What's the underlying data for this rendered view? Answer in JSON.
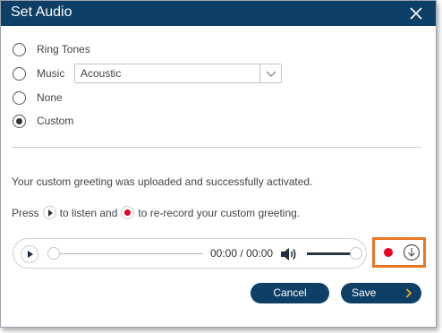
{
  "dialog": {
    "title": "Set Audio"
  },
  "options": [
    {
      "label": "Ring Tones",
      "checked": false
    },
    {
      "label": "Music",
      "checked": false
    },
    {
      "label": "None",
      "checked": false
    },
    {
      "label": "Custom",
      "checked": true
    }
  ],
  "music_select": {
    "value": "Acoustic"
  },
  "messages": {
    "uploaded": "Your custom greeting was uploaded and successfully activated.",
    "press": "Press",
    "to_listen": "to listen and",
    "to_rerecord": "to re-record your custom greeting."
  },
  "player": {
    "time": "00:00 / 00:00",
    "position": 0,
    "volume": 1.0
  },
  "buttons": {
    "cancel": "Cancel",
    "save": "Save"
  },
  "colors": {
    "header": "#0e3f66",
    "record": "#e8001c",
    "highlight": "#e87722",
    "save_chevron": "#f5a623"
  },
  "icons": {
    "close": "close-icon",
    "play": "play-icon",
    "record": "record-icon",
    "volume": "volume-icon",
    "download": "download-icon",
    "chevron": "chevron-right-icon",
    "dropdown": "chevron-down-icon"
  }
}
